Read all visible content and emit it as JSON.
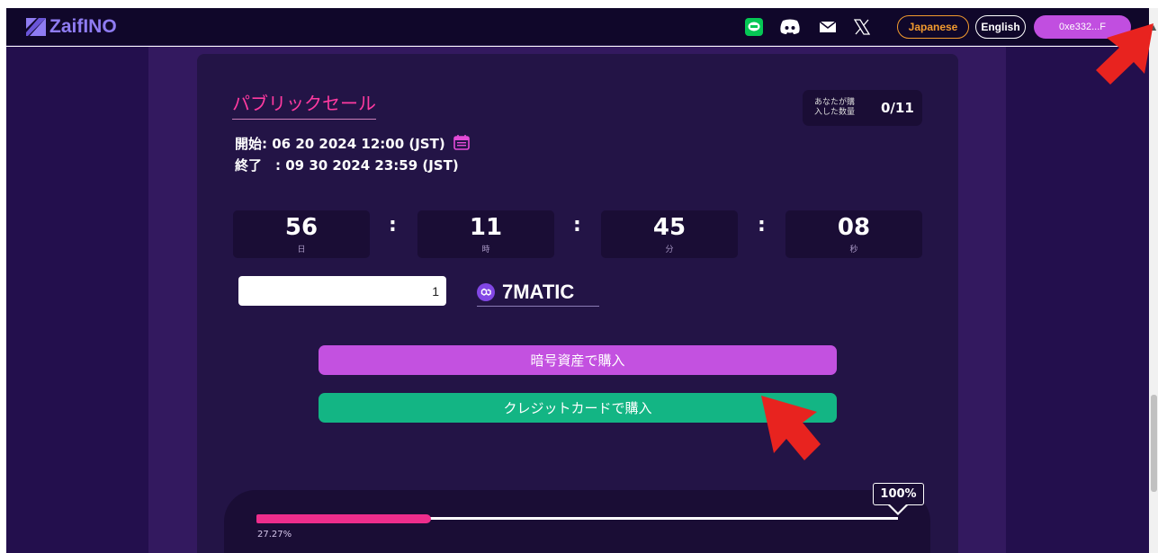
{
  "header": {
    "logo_text": "ZaifINO",
    "social_icons": [
      "line-icon",
      "discord-icon",
      "mail-icon",
      "x-icon"
    ],
    "lang_japanese": "Japanese",
    "lang_english": "English",
    "wallet_label": "0xe332...F"
  },
  "sale": {
    "title": "パブリックセール",
    "start": "開始: 06 20 2024 12:00 (JST)",
    "end": "終了　: 09 30 2024 23:59 (JST)",
    "purchased_label_line1": "あなたが購",
    "purchased_label_line2": "入した数量",
    "purchased_count": "0/11"
  },
  "countdown": {
    "days": "56",
    "days_unit": "日",
    "hours": "11",
    "hours_unit": "時",
    "minutes": "45",
    "minutes_unit": "分",
    "seconds": "08",
    "seconds_unit": "秒",
    "separator": ":"
  },
  "purchase": {
    "quantity_value": "1",
    "price": "7MATIC",
    "buy_crypto_label": "暗号資産で購入",
    "buy_card_label": "クレジットカードで購入"
  },
  "progress": {
    "percent_label": "27.27%",
    "fraction": 0.2727,
    "max_label": "100%"
  },
  "colors": {
    "accent_pink": "#ff3aa0",
    "crypto_button": "#c351e0",
    "card_button": "#13b584",
    "progress_fill": "#ee2d8c"
  }
}
